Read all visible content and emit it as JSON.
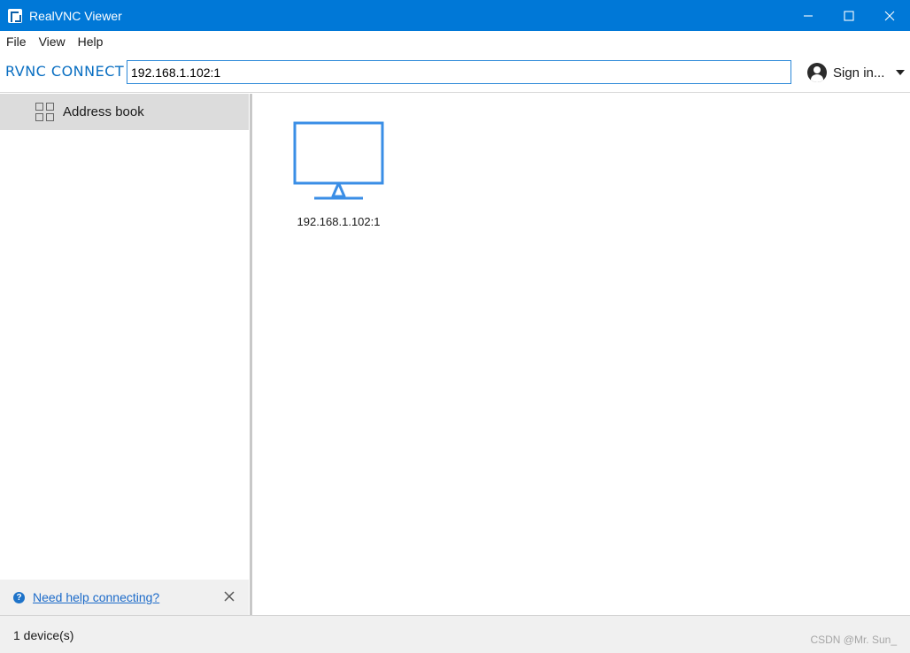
{
  "window": {
    "title": "RealVNC Viewer",
    "controls": [
      "minimize-icon",
      "maximize-icon",
      "close-icon"
    ]
  },
  "menu": {
    "items": [
      "File",
      "View",
      "Help"
    ]
  },
  "toolbar": {
    "brand": "RVNC CONNECT",
    "address_value": "192.168.1.102:1",
    "signin_label": "Sign in...",
    "accent": "#0078d7"
  },
  "sidebar": {
    "items": [
      {
        "label": "Address book",
        "icon": "grid-icon",
        "selected": true
      }
    ],
    "help": {
      "link": "Need help connecting?",
      "icon": "help-icon"
    }
  },
  "main": {
    "devices": [
      {
        "label": "192.168.1.102:1",
        "icon": "monitor-icon"
      }
    ],
    "monitor_color": "#3a8ee6"
  },
  "status": {
    "count": "1 device(s)",
    "watermark": "CSDN @Mr. Sun_"
  }
}
